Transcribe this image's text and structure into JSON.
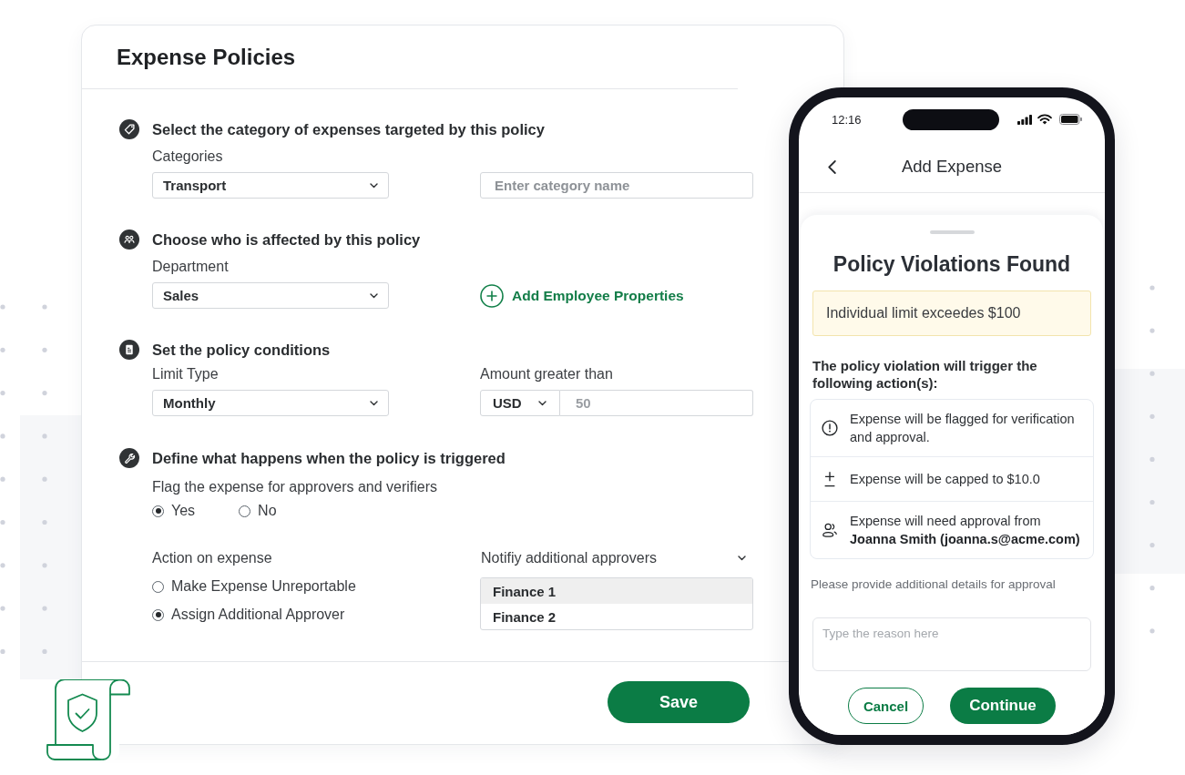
{
  "policy_card": {
    "title": "Expense Policies",
    "category_section": {
      "heading": "Select the category of expenses targeted by this policy",
      "label": "Categories",
      "category_select": "Transport",
      "category_name_field": {
        "placeholder": "Enter category name"
      }
    },
    "audience_section": {
      "heading": "Choose who is affected by this policy",
      "label": "Department",
      "department_select": "Sales",
      "add_link": "Add Employee Properties"
    },
    "conditions_section": {
      "heading": "Set the policy conditions",
      "limit_label": "Limit Type",
      "limit_select": "Monthly",
      "amount_label": "Amount greater than",
      "currency_select": "USD",
      "amount_field": {
        "placeholder": "50"
      }
    },
    "trigger_section": {
      "heading": "Define what happens when the policy is triggered",
      "flag_label": "Flag the expense for approvers and verifiers",
      "flag_options": [
        {
          "label": "Yes",
          "selected": true
        },
        {
          "label": "No",
          "selected": false
        }
      ],
      "action_label": "Action on expense",
      "action_options": [
        {
          "label": "Make Expense Unreportable",
          "selected": false
        },
        {
          "label": "Assign Additional Approver",
          "selected": true
        }
      ],
      "approvers_label": "Notifiy additional approvers",
      "approvers": [
        {
          "label": "Finance 1",
          "selected": true
        },
        {
          "label": "Finance 2",
          "selected": false
        }
      ]
    },
    "save_button": "Save"
  },
  "phone": {
    "status_bar": {
      "time": "12:16"
    },
    "header": {
      "title": "Add Expense"
    },
    "violations_sheet": {
      "title": "Policy Violations Found",
      "alert": "Individual limit exceedes $100",
      "actions_heading": "The policy violation will trigger the following action(s):",
      "actions": [
        {
          "kind": "flag",
          "text": "Expense will be flagged for verification and approval."
        },
        {
          "kind": "cap",
          "text": "Expense will be capped to $10.0"
        },
        {
          "kind": "approval",
          "text": "Expense will need approval from **Joanna Smith (joanna.s@acme.com)**"
        }
      ],
      "details_label": "Please provide additional details for approval",
      "reason_field": {
        "placeholder": "Type the reason here"
      },
      "buttons": [
        {
          "kind": "secondary",
          "label": "Cancel"
        },
        {
          "kind": "primary",
          "label": "Continue"
        }
      ]
    }
  }
}
